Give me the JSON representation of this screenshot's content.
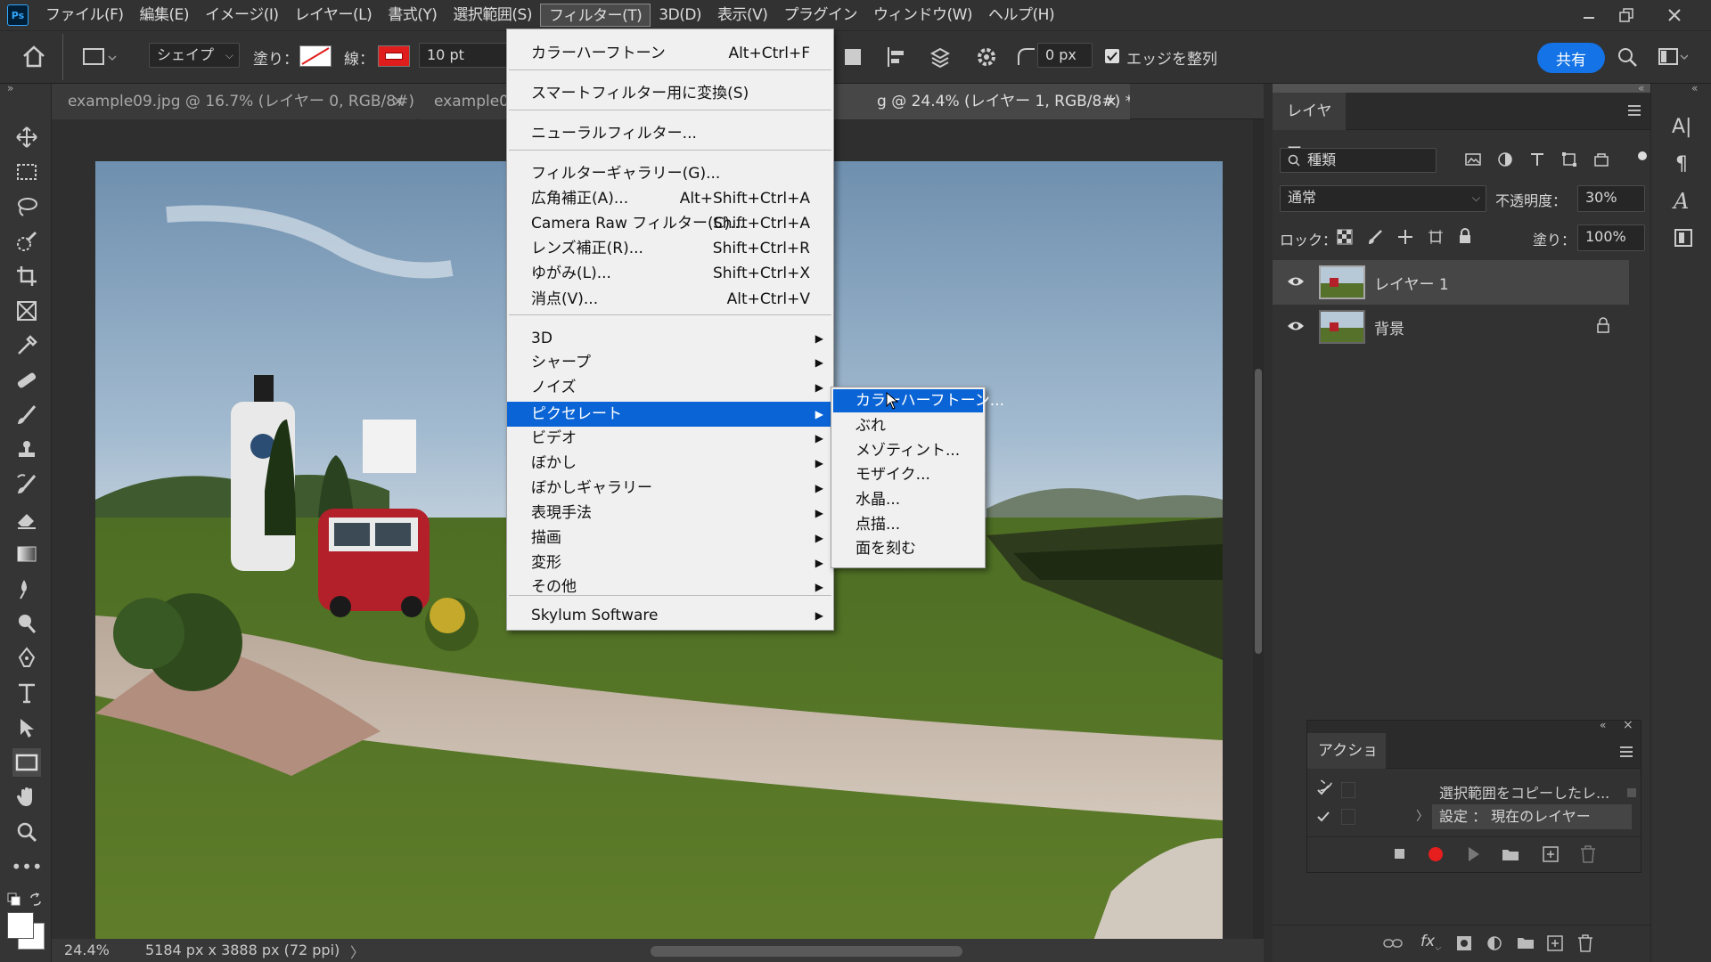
{
  "menubar": {
    "logo": "Ps",
    "items": [
      "ファイル(F)",
      "編集(E)",
      "イメージ(I)",
      "レイヤー(L)",
      "書式(Y)",
      "選択範囲(S)",
      "フィルター(T)",
      "3D(D)",
      "表示(V)",
      "プラグイン",
      "ウィンドウ(W)",
      "ヘルプ(H)"
    ],
    "active_index": 6
  },
  "options": {
    "mode": "シェイプ",
    "fill_label": "塗り：",
    "stroke_label": "線：",
    "stroke_width": "10 pt",
    "radius": "0 px",
    "align_edges_label": "エッジを整列",
    "share_label": "共有",
    "stroke_color": "#e01d1d"
  },
  "tabs": [
    {
      "label": "example09.jpg @ 16.7% (レイヤー 0, RGB/8#) *",
      "close": "×"
    },
    {
      "label": "example06",
      "close": ""
    },
    {
      "label": "g @ 24.4% (レイヤー 1, RGB/8#) *",
      "close": "×"
    }
  ],
  "filter_menu": {
    "items": [
      {
        "label": "カラーハーフトーン",
        "shortcut": "Alt+Ctrl+F"
      },
      {
        "label": "スマートフィルター用に変換(S)",
        "shortcut": ""
      },
      {
        "label": "ニューラルフィルター...",
        "shortcut": ""
      },
      {
        "label": "フィルターギャラリー(G)...",
        "shortcut": ""
      },
      {
        "label": "広角補正(A)...",
        "shortcut": "Alt+Shift+Ctrl+A"
      },
      {
        "label": "Camera Raw フィルター(C)...",
        "shortcut": "Shift+Ctrl+A"
      },
      {
        "label": "レンズ補正(R)...",
        "shortcut": "Shift+Ctrl+R"
      },
      {
        "label": "ゆがみ(L)...",
        "shortcut": "Shift+Ctrl+X"
      },
      {
        "label": "消点(V)...",
        "shortcut": "Alt+Ctrl+V"
      },
      {
        "label": "3D",
        "shortcut": ""
      },
      {
        "label": "シャープ",
        "shortcut": ""
      },
      {
        "label": "ノイズ",
        "shortcut": ""
      },
      {
        "label": "ピクセレート",
        "shortcut": ""
      },
      {
        "label": "ビデオ",
        "shortcut": ""
      },
      {
        "label": "ぼかし",
        "shortcut": ""
      },
      {
        "label": "ぼかしギャラリー",
        "shortcut": ""
      },
      {
        "label": "表現手法",
        "shortcut": ""
      },
      {
        "label": "描画",
        "shortcut": ""
      },
      {
        "label": "変形",
        "shortcut": ""
      },
      {
        "label": "その他",
        "shortcut": ""
      },
      {
        "label": "Skylum Software",
        "shortcut": ""
      }
    ],
    "highlighted": "ピクセレート"
  },
  "pixelate_submenu": {
    "items": [
      "カラーハーフトーン...",
      "ぶれ",
      "メゾティント...",
      "モザイク...",
      "水晶...",
      "点描...",
      "面を刻む"
    ],
    "highlighted_index": 0
  },
  "layers_panel": {
    "title": "レイヤー",
    "filter_kind": "種類",
    "blend_mode": "通常",
    "opacity_label": "不透明度：",
    "opacity": "30%",
    "lock_label": "ロック：",
    "fill_label": "塗り：",
    "fill": "100%",
    "layers": [
      {
        "name": "レイヤー 1",
        "selected": true,
        "locked": false
      },
      {
        "name": "背景",
        "selected": false,
        "locked": true
      }
    ]
  },
  "actions_panel": {
    "title": "アクション",
    "rows": [
      "選択範囲をコピーしたレ...",
      "設定 ： 現在のレイヤー"
    ]
  },
  "status": {
    "zoom": "24.4%",
    "doc_size": "5184 px x 3888 px (72 ppi)"
  }
}
